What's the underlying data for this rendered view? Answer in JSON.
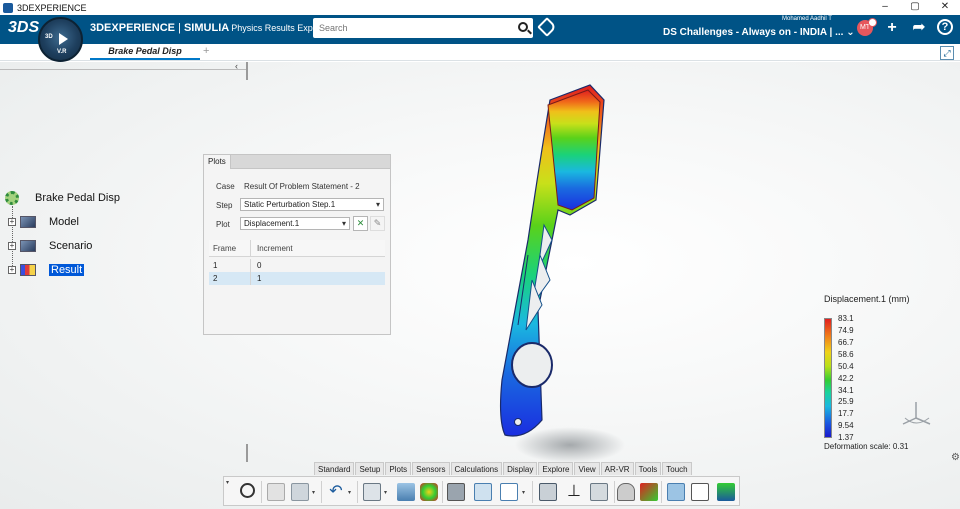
{
  "os": {
    "title": "3DEXPERIENCE",
    "controls": [
      "–",
      "▢",
      "✕"
    ]
  },
  "header": {
    "ds_logo": "3DS",
    "brand_bold": "3DEXPERIENCE",
    "brand_sep": " | ",
    "brand_product": "SIMULIA",
    "brand_app": "Physics Results Explorer",
    "compass_3d": "3D",
    "compass_version": "V.R",
    "search_placeholder": "Search",
    "user_name": "Mohamed Aadhil T",
    "collab_space": "DS Challenges - Always on - INDIA | ...",
    "avatar_initials": "MT"
  },
  "tabs": [
    {
      "label": "Brake Pedal Disp"
    }
  ],
  "tree": {
    "root": "Brake Pedal Disp",
    "nodes": [
      {
        "label": "Model"
      },
      {
        "label": "Scenario"
      },
      {
        "label": "Result"
      }
    ]
  },
  "plots_panel": {
    "title": "Plots",
    "case_label": "Case",
    "case_value": "Result Of Problem Statement - 2",
    "step_label": "Step",
    "step_value": "Static Perturbation Step.1",
    "plot_label": "Plot",
    "plot_value": "Displacement.1",
    "columns": [
      "Frame",
      "Increment"
    ],
    "rows": [
      [
        "1",
        "0"
      ],
      [
        "2",
        "1"
      ]
    ]
  },
  "legend": {
    "title": "Displacement.1 (mm)",
    "values": [
      "83.1",
      "74.9",
      "66.7",
      "58.6",
      "50.4",
      "42.2",
      "34.1",
      "25.9",
      "17.7",
      "9.54",
      "1.37"
    ],
    "deformation": "Deformation scale: 0.31"
  },
  "toolbar": {
    "tabs": [
      "Standard",
      "Setup",
      "Plots",
      "Sensors",
      "Calculations",
      "Display",
      "Explore",
      "View",
      "AR-VR",
      "Tools",
      "Touch"
    ]
  }
}
